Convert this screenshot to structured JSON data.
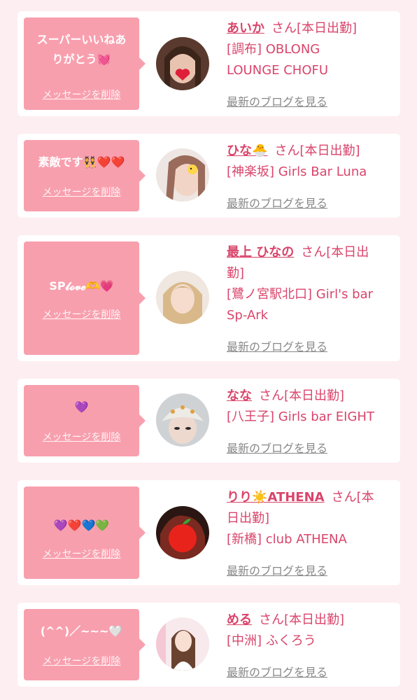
{
  "delete_label": "メッセージを削除",
  "blog_label": "最新のブログを見る",
  "entries": [
    {
      "message_line1": "スーパーいいねあ",
      "message_line2": "りがとう💓",
      "name": "あいか",
      "suffix": "さん[本日出勤]",
      "shop_line1": "[調布] OBLONG",
      "shop_line2": "LOUNGE CHOFU",
      "avatar_icon": "girl-portrait-heart-sticker"
    },
    {
      "message": "素敵です👯❤️❤️",
      "name": "ひな🐣",
      "suffix": "さん[本日出勤]",
      "shop": "[神楽坂] Girls Bar Luna",
      "avatar_icon": "girl-portrait-chick-sticker"
    },
    {
      "message": "SP𝓵𝓸𝓿𝓮🫶💗",
      "name": "最上 ひなの",
      "suffix_line1": "さん[本日出",
      "suffix_line2": "勤]",
      "shop_line1": "[鷺ノ宮駅北口] Girl's bar",
      "shop_line2": "Sp-Ark",
      "avatar_icon": "blonde-girl-portrait"
    },
    {
      "message": "💜",
      "name": "なな",
      "suffix": "さん[本日出勤]",
      "shop": "[八王子] Girls bar EIGHT",
      "avatar_icon": "girl-portrait-hat"
    },
    {
      "message": "💜❤️💙💚",
      "name": "りり☀️ATHENA",
      "suffix_line1": "さん[本",
      "suffix_line2": "日出勤]",
      "shop": "[新橋] club ATHENA",
      "avatar_icon": "girl-portrait-apple-sticker"
    },
    {
      "message": "(^^)／~~~🤍",
      "name": "める",
      "suffix": "さん[本日出勤]",
      "shop": "[中洲] ふくろう",
      "avatar_icon": "girl-portrait-pink-room"
    }
  ],
  "colors": {
    "background": "#fdeef1",
    "bubble": "#f89fae",
    "accent": "#d9456b",
    "link_gray": "#888888"
  }
}
